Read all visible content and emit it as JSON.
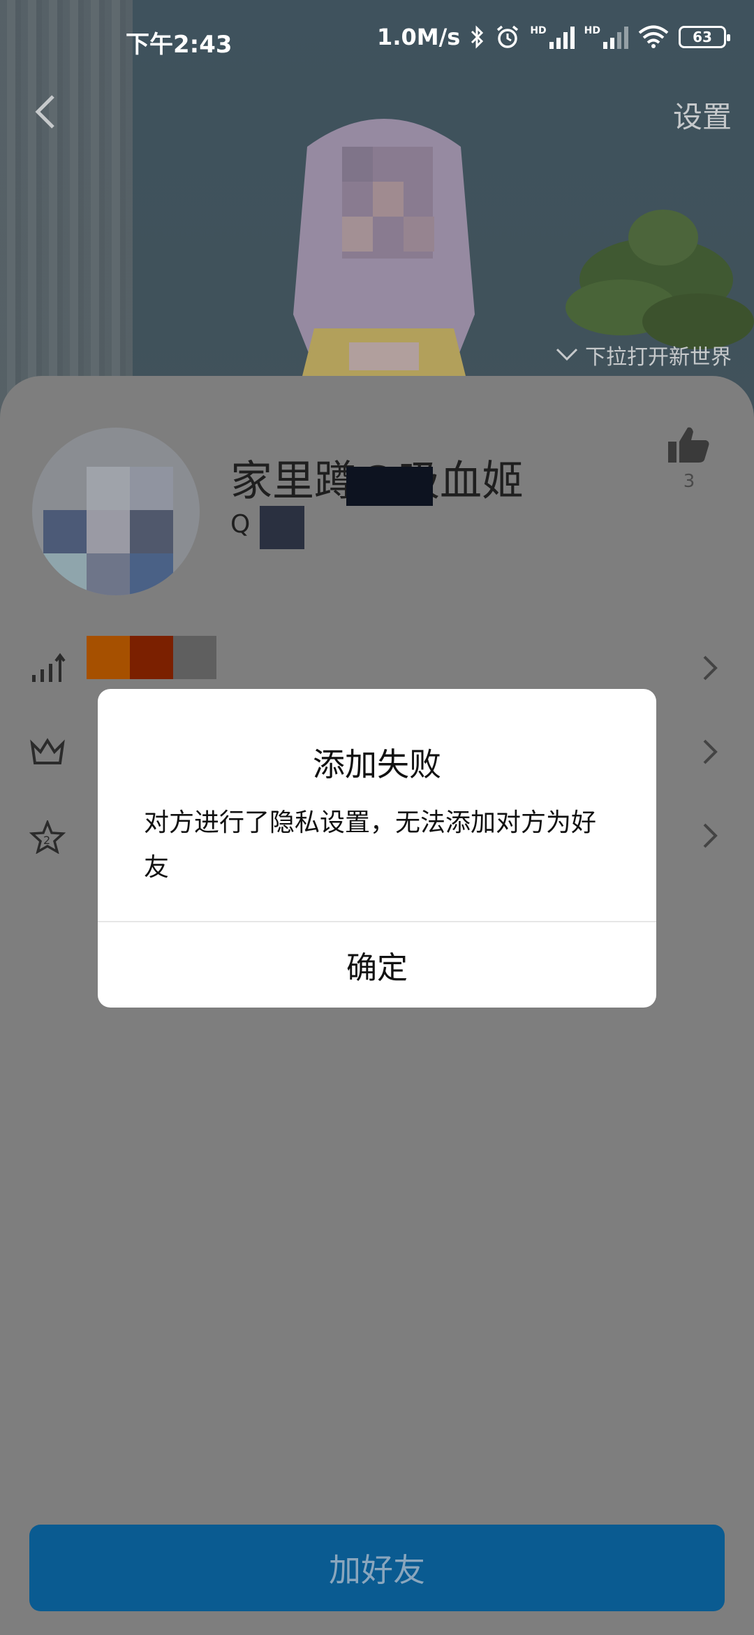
{
  "status_bar": {
    "time": "下午2:43",
    "network_speed": "1.0M/s",
    "signal_1_label": "HD",
    "signal_2_label": "HD",
    "battery_level": "63",
    "icons": [
      "bluetooth-icon",
      "alarm-icon",
      "signal-icon",
      "signal-icon",
      "wifi-icon",
      "battery-icon"
    ]
  },
  "header": {
    "settings_label": "设置",
    "pull_hint": "下拉打开新世界",
    "back_icon": "back-arrow-icon"
  },
  "profile": {
    "nickname": "家里蹲の吸血姬",
    "qq_prefix": "Q",
    "like_count": "3",
    "like_icon": "thumbs-up-icon"
  },
  "rows": [
    {
      "icon": "level-chart-icon",
      "label": ""
    },
    {
      "icon": "crown-icon",
      "label": ""
    },
    {
      "icon": "star-badge-icon",
      "label": ""
    }
  ],
  "dialog": {
    "title": "添加失败",
    "message": "对方进行了隐私设置，无法添加对方为好友",
    "confirm_label": "确定"
  },
  "footer": {
    "add_friend_label": "加好友"
  },
  "colors": {
    "accent": "#0a5b91",
    "overlay": "#7e7e7e",
    "dialog_bg": "#ffffff"
  }
}
